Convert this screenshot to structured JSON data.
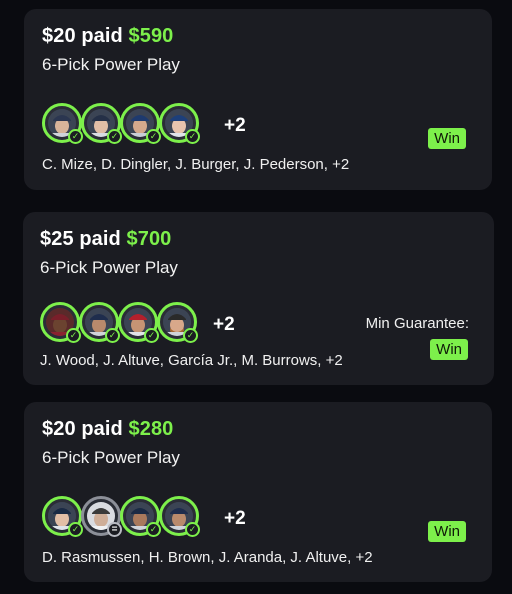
{
  "cards": [
    {
      "paid": "$20 paid",
      "won": "$590",
      "type": "6-Pick Power Play",
      "more": "+2",
      "names": "C. Mize, D. Dingler, J. Burger, J. Pederson, +2",
      "result": "Win",
      "result_label": ""
    },
    {
      "paid": "$25 paid",
      "won": "$700",
      "type": "6-Pick Power Play",
      "more": "+2",
      "names": "J. Wood, J. Altuve, García Jr., M. Burrows, +2",
      "result": "Win",
      "result_label": "Min Guarantee:"
    },
    {
      "paid": "$20 paid",
      "won": "$280",
      "type": "6-Pick Power Play",
      "more": "+2",
      "names": "D. Rasmussen, H. Brown, J. Aranda, J. Altuve, +2",
      "result": "Win",
      "result_label": ""
    }
  ],
  "colors": {
    "accent": "#7df04b",
    "card_bg": "#1b1c22",
    "page_bg": "#0a0b10"
  },
  "icons": {
    "status_win": "check-icon",
    "status_push": "equals-icon"
  }
}
